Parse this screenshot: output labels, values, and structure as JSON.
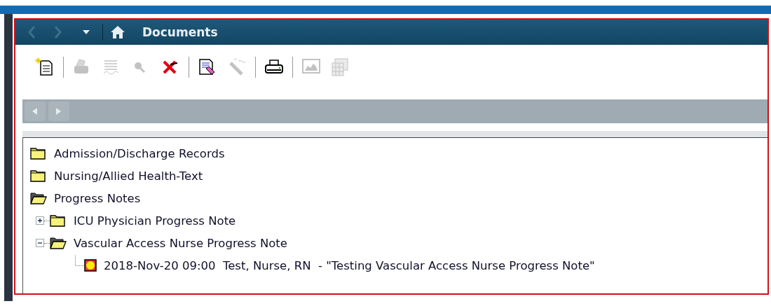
{
  "nav": {
    "back": {
      "disabled": true
    },
    "forward": {
      "disabled": true
    },
    "title": "Documents"
  },
  "toolbar": [
    [
      {
        "kind": "new-document",
        "disabled": false
      }
    ],
    [
      {
        "kind": "forward-doc",
        "disabled": true
      },
      {
        "kind": "sign",
        "disabled": true
      },
      {
        "kind": "search",
        "disabled": true
      },
      {
        "kind": "delete",
        "disabled": false
      }
    ],
    [
      {
        "kind": "edit-document",
        "disabled": false
      },
      {
        "kind": "wand",
        "disabled": true
      }
    ],
    [
      {
        "kind": "print",
        "disabled": false
      }
    ],
    [
      {
        "kind": "chart",
        "disabled": true
      },
      {
        "kind": "grid",
        "disabled": true
      }
    ]
  ],
  "pager": {
    "prev": {
      "disabled": true
    },
    "next": {
      "disabled": true
    }
  },
  "tree": [
    {
      "label": "Admission/Discharge Records",
      "kind": "folder",
      "expanded": false
    },
    {
      "label": "Nursing/Allied Health-Text",
      "kind": "folder",
      "expanded": false
    },
    {
      "label": "Progress Notes",
      "kind": "folder",
      "expanded": true,
      "children": [
        {
          "label": "ICU Physician Progress Note",
          "kind": "folder",
          "expanded": false
        },
        {
          "label": "Vascular Access Nurse Progress Note",
          "kind": "folder",
          "expanded": true,
          "children": [
            {
              "label": "2018-Nov-20 09:00  Test, Nurse, RN  - \"Testing Vascular Access Nurse Progress Note\"",
              "kind": "document"
            }
          ]
        }
      ]
    }
  ]
}
